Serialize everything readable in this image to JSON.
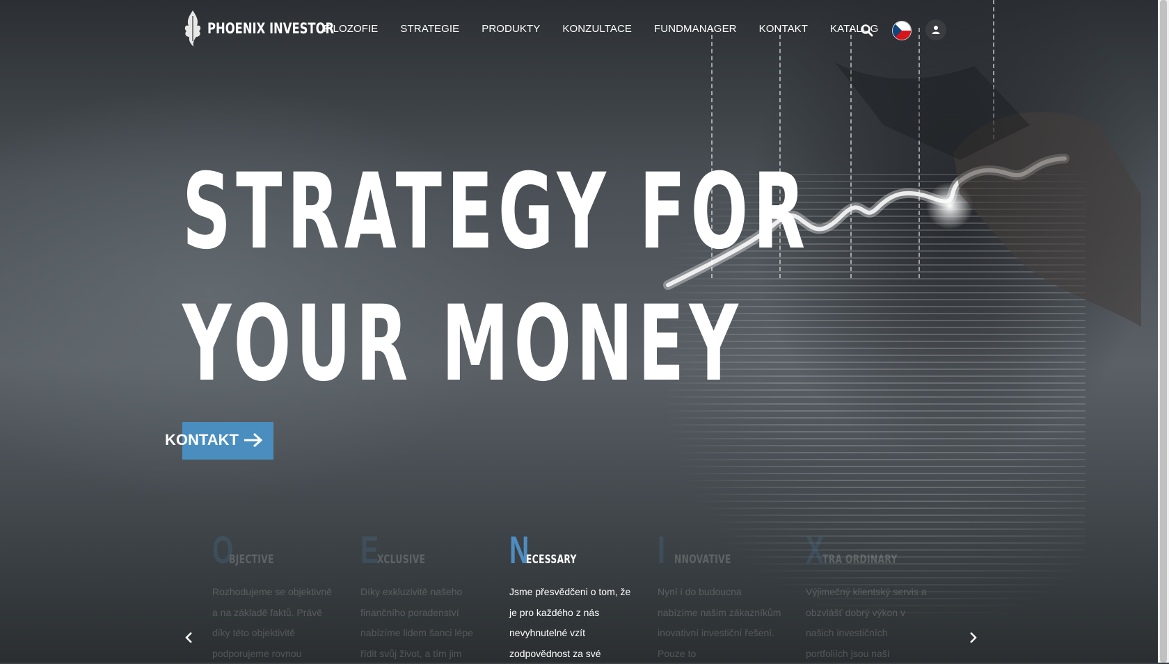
{
  "brand": {
    "name": "PHOENIX INVESTOR"
  },
  "nav": {
    "items": [
      "FILOZOFIE",
      "STRATEGIE",
      "PRODUKTY",
      "KONZULTACE",
      "FUNDMANAGER",
      "KONTAKT",
      "KATALOG"
    ],
    "icons": [
      "search-icon",
      "czech-flag-icon",
      "user-icon"
    ]
  },
  "hero": {
    "headline_line1": "STRATEGY FOR",
    "headline_line2": "YOUR MONEY",
    "cta_label": "KONTAKT"
  },
  "features": [
    {
      "letter": "O",
      "word": "BJECTIVE",
      "text": "Rozhodujeme se objektivně a na základě faktů. Právě díky této objektivitě podporujeme rovnou",
      "active": false
    },
    {
      "letter": "E",
      "word": "XCLUSIVE",
      "text": "Díky exkluzivitě našeho finančního poradenství nabízíme lidem šanci lépe řídit svůj život, a tím jim",
      "active": false
    },
    {
      "letter": "N",
      "word": "ECESSARY",
      "text": "Jsme přesvědčeni o tom, že je pro každého z nás nevyhnutelné vzít zodpovědnost za své",
      "active": true
    },
    {
      "letter": "I",
      "word": "NNOVATIVE",
      "text": "Nyní i do budoucna nabízíme našim zákazníkům inovativní investiční řešení. Pouze to",
      "active": false
    },
    {
      "letter": "X",
      "word": "TRA ORDINARY",
      "text": "Výjimečný klientský servis a obzvlášť dobrý výkon v našich investičních portfoliích jsou naší",
      "active": false
    }
  ],
  "slider": {
    "prev_icon": "chevron-left-icon",
    "next_icon": "chevron-right-icon"
  },
  "colors": {
    "accent": "#4a8ec0",
    "letter_accent": "#4f8cc1",
    "text": "#ffffff"
  }
}
